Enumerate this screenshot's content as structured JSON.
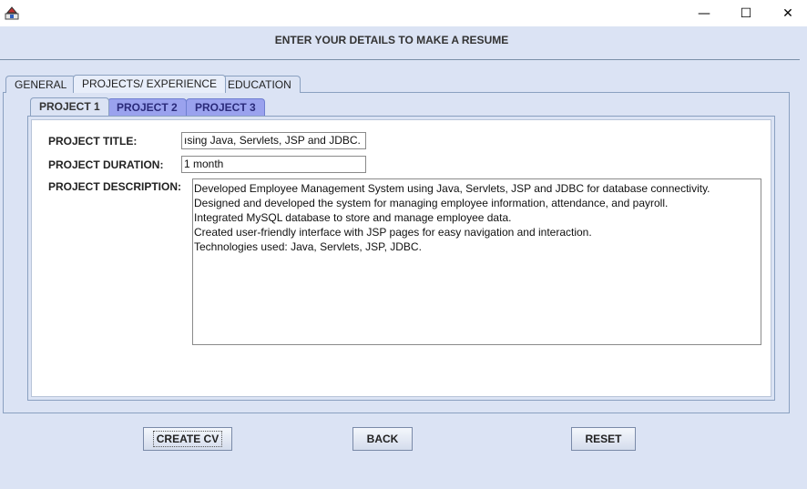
{
  "window": {
    "min_glyph": "—",
    "max_glyph": "☐",
    "close_glyph": "✕"
  },
  "heading": "ENTER YOUR DETAILS TO MAKE A RESUME",
  "outer_tabs": [
    {
      "label": "GENERAL"
    },
    {
      "label": "PROJECTS/ EXPERIENCE"
    },
    {
      "label": "EDUCATION"
    }
  ],
  "inner_tabs": [
    {
      "label": "PROJECT 1"
    },
    {
      "label": "PROJECT 2"
    },
    {
      "label": "PROJECT 3"
    }
  ],
  "form": {
    "title_label": "PROJECT TITLE:",
    "title_value": "ısing Java, Servlets, JSP and JDBC.",
    "duration_label": "PROJECT DURATION:",
    "duration_value": "1 month",
    "description_label": "PROJECT DESCRIPTION:",
    "description_lines": [
      "Developed Employee Management System using Java, Servlets, JSP and JDBC for database connectivity.",
      "Designed and developed the system for managing employee information, attendance, and payroll.",
      "Integrated MySQL database to store and manage employee data.",
      "Created user-friendly interface with JSP pages for easy navigation and interaction.",
      "Technologies used: Java, Servlets, JSP, JDBC."
    ]
  },
  "buttons": {
    "create": "CREATE CV",
    "back": "BACK",
    "reset": "RESET"
  }
}
